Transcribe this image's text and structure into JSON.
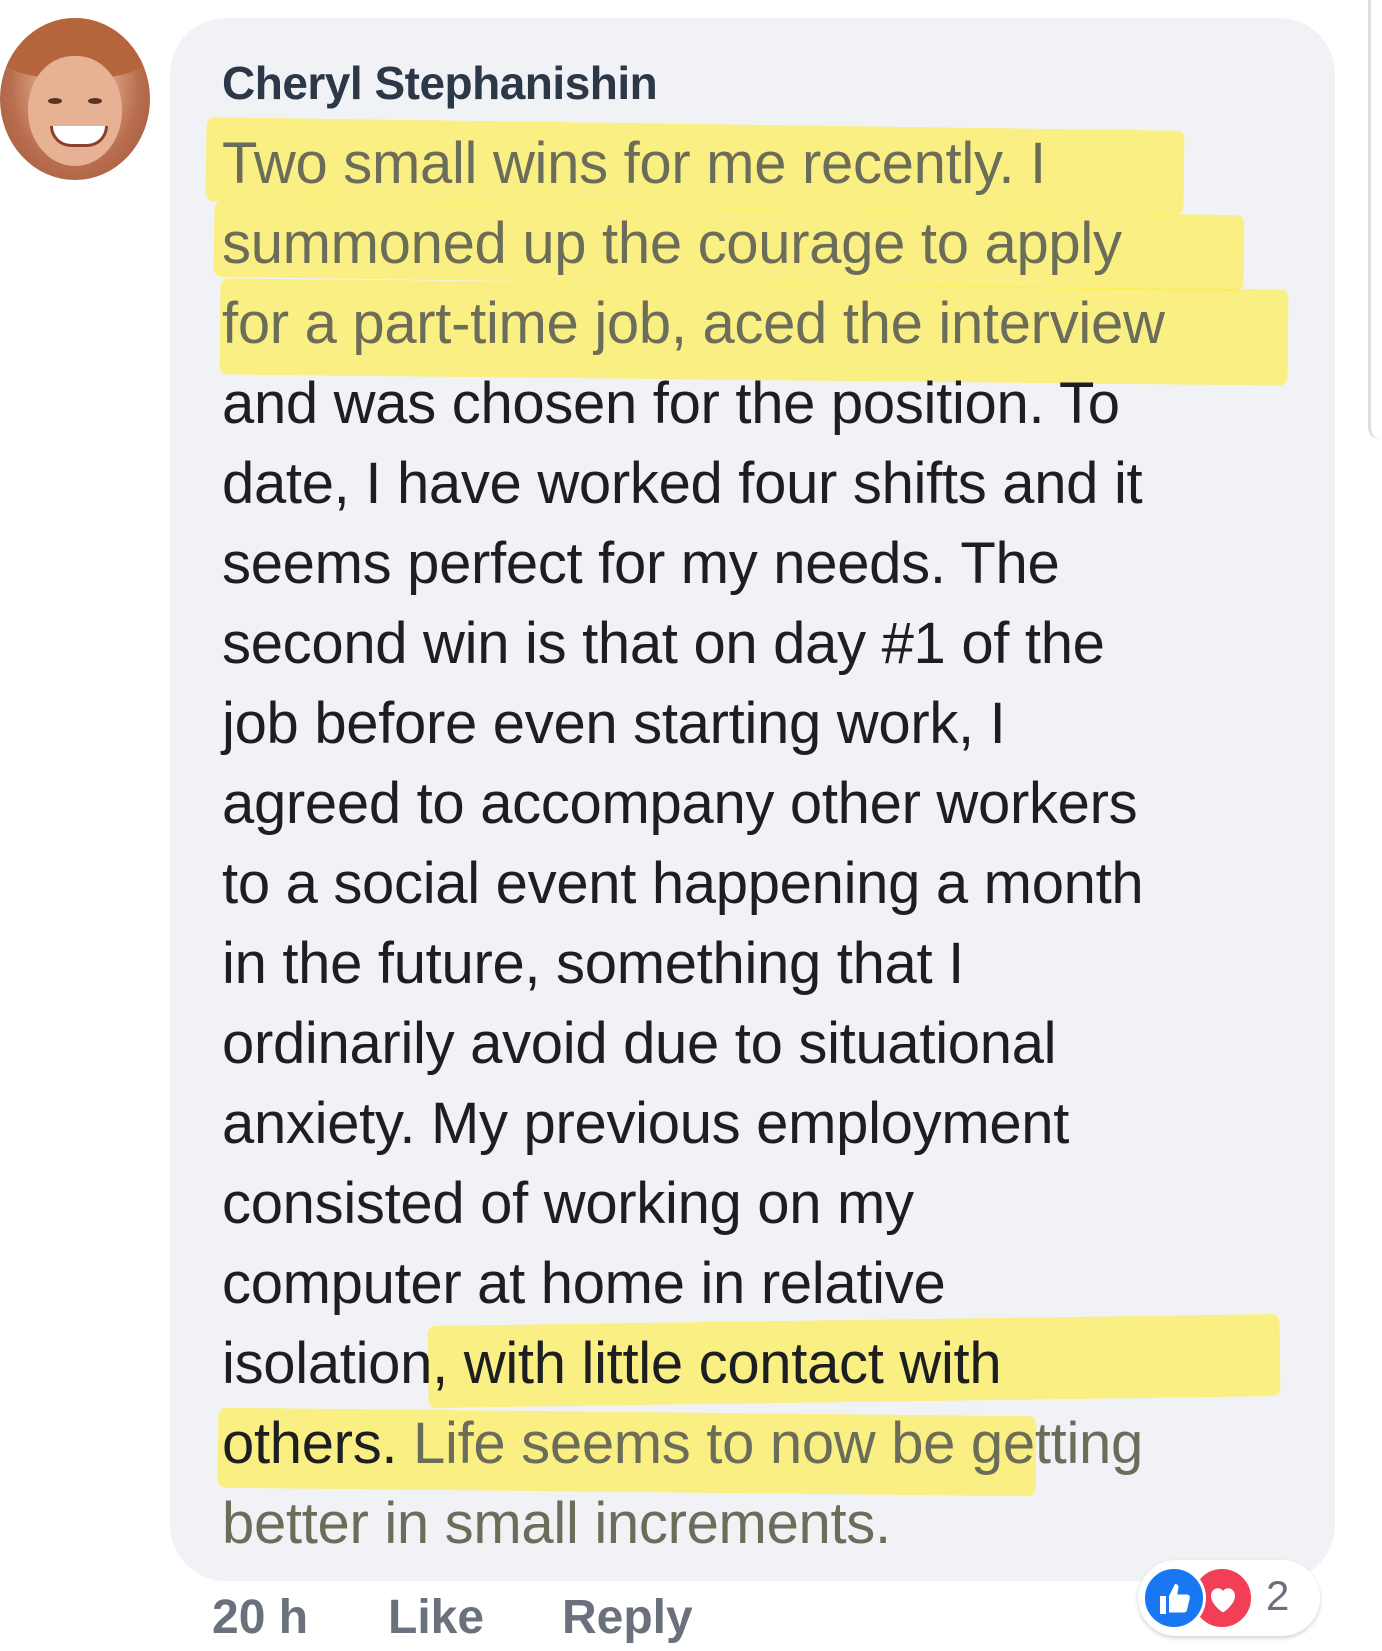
{
  "comment": {
    "author": "Cheryl Stephanishin",
    "lines": [
      {
        "parts": [
          "Two small wins for me recently.  I"
        ]
      },
      {
        "parts": [
          "summoned up the courage to apply"
        ]
      },
      {
        "parts": [
          "for a part-time job, aced the interview"
        ]
      },
      {
        "parts": [
          "and was chosen for the position.  To"
        ]
      },
      {
        "parts": [
          "date, I have worked four shifts and it"
        ]
      },
      {
        "parts": [
          "seems perfect for my needs.  The"
        ]
      },
      {
        "parts": [
          "second win is that on day #1 of the"
        ]
      },
      {
        "parts": [
          "job before even starting work, I"
        ]
      },
      {
        "parts": [
          "agreed to accompany other workers"
        ]
      },
      {
        "parts": [
          "to a social event happening a month"
        ]
      },
      {
        "parts": [
          "in the future, something that I"
        ]
      },
      {
        "parts": [
          "ordinarily avoid due to situational"
        ]
      },
      {
        "parts": [
          "anxiety.  My previous employment"
        ]
      },
      {
        "parts": [
          "consisted of working on my"
        ]
      },
      {
        "parts": [
          "computer at home in relative"
        ]
      },
      {
        "parts": [
          "isolation, with little contact with"
        ]
      },
      {
        "parts": [
          "others.  ",
          "Life seems to now be getting"
        ]
      },
      {
        "parts": [
          "better in small increments."
        ]
      }
    ]
  },
  "meta": {
    "time": "20 h",
    "like_label": "Like",
    "reply_label": "Reply"
  },
  "reactions": {
    "count": "2",
    "types": [
      "like-icon",
      "love-icon"
    ],
    "like_color": "#1877f2",
    "love_color": "#f33e58"
  },
  "highlight_color": "#ffee3c"
}
